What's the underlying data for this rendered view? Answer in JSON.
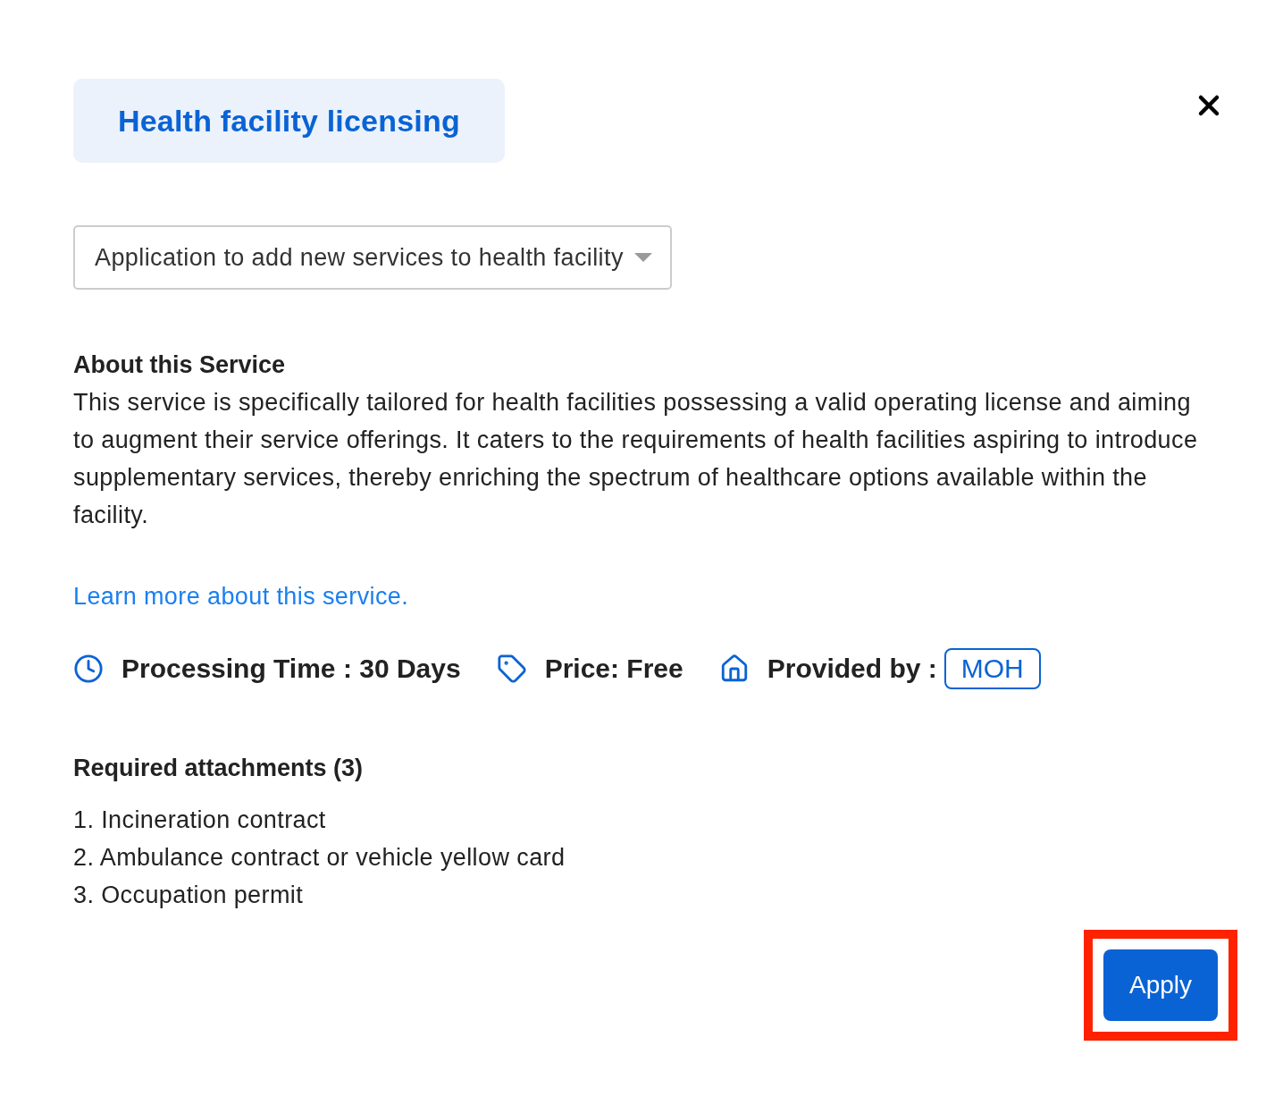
{
  "dialog": {
    "title": "Health facility licensing"
  },
  "service_select": {
    "value": "Application to add new services to health facility"
  },
  "about": {
    "heading": "About this Service",
    "text": "This service is specifically tailored for health facilities possessing a valid operating license and aiming to augment their service offerings. It caters to the requirements of health facilities aspiring to introduce supplementary services, thereby enriching the spectrum of healthcare options available within the facility."
  },
  "learn_more_link": "Learn more about this service.",
  "details": [
    {
      "kind": "time",
      "text": "Processing Time : 30 Days"
    },
    {
      "kind": "price",
      "text": "Price: Free"
    },
    {
      "kind": "provider",
      "text": "Provided by :",
      "badge": "MOH"
    }
  ],
  "attachments": {
    "heading": "Required attachments (3)",
    "items": [
      {
        "number": "1.",
        "text": "Incineration contract"
      },
      {
        "number": "2.",
        "text": "Ambulance contract or vehicle yellow card"
      },
      {
        "number": "3.",
        "text": "Occupation permit"
      }
    ]
  },
  "apply_button": {
    "label": "Apply",
    "highlighted": true
  }
}
